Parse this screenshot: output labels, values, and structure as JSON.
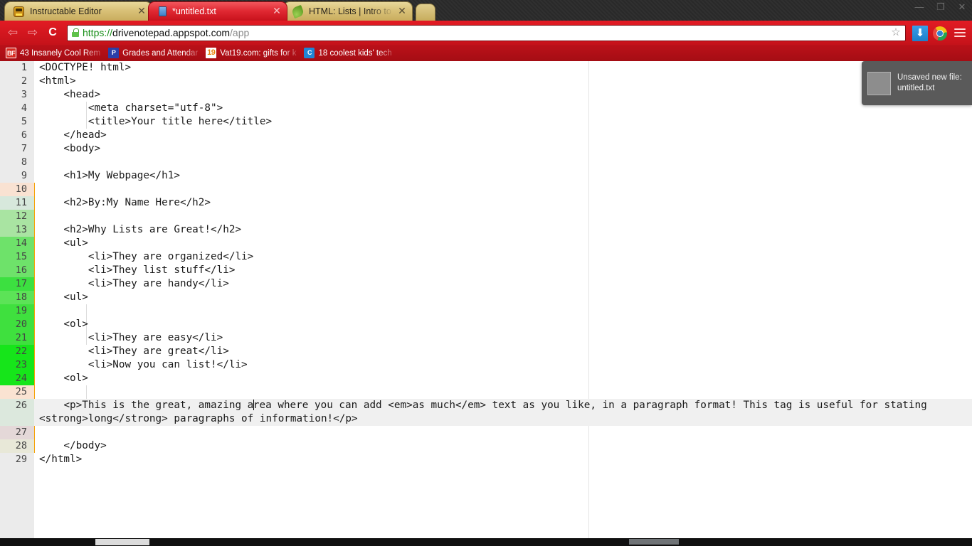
{
  "window": {
    "controls": [
      {
        "name": "minimize",
        "glyph": "—"
      },
      {
        "name": "maximize",
        "glyph": "❐"
      },
      {
        "name": "close",
        "glyph": "✕"
      }
    ]
  },
  "tabs": [
    {
      "title": "Instructable Editor",
      "favicon": "robot-icon",
      "active": false,
      "close": "✕"
    },
    {
      "title": "*untitled.txt",
      "favicon": "document-icon",
      "active": true,
      "close": "✕"
    },
    {
      "title": "HTML: Lists | Intro to HT",
      "favicon": "leaf-icon",
      "active": false,
      "close": "✕"
    }
  ],
  "toolbar": {
    "back": "⇦",
    "forward": "⇨",
    "reload": "C",
    "lock": "lock-icon",
    "url_scheme": "https://",
    "url_host": "drivenotepad.appspot.com",
    "url_path": "/app",
    "bookmark_star": "☆",
    "download_icon": "⬇",
    "profile_icon": "chrome-icon",
    "menu_icon": "hamburger-icon"
  },
  "bookmarks": [
    {
      "label": "43 Insanely Cool Rem",
      "favicon_text": "BF",
      "favicon_style": "bmf-bf"
    },
    {
      "label": "Grades and Attendar",
      "favicon_text": "P",
      "favicon_style": "bmf-p"
    },
    {
      "label": "Vat19.com: gifts for k",
      "favicon_text": "19",
      "favicon_style": "bmf-19"
    },
    {
      "label": "18 coolest kids' tech",
      "favicon_text": "C",
      "favicon_style": "bmf-c"
    }
  ],
  "toast": {
    "line1": "Unsaved new file:",
    "line2": "untitled.txt"
  },
  "editor": {
    "lines": [
      {
        "n": "1",
        "text": "<DOCTYPE! html>",
        "gutter": "#ebebeb"
      },
      {
        "n": "2",
        "text": "<html>",
        "gutter": "#ebebeb"
      },
      {
        "n": "3",
        "text": "    <head>",
        "gutter": "#ebebeb"
      },
      {
        "n": "4",
        "text": "        <meta charset=\"utf-8\">",
        "gutter": "#ebebeb"
      },
      {
        "n": "5",
        "text": "        <title>Your title here</title>",
        "gutter": "#ebebeb"
      },
      {
        "n": "6",
        "text": "    </head>",
        "gutter": "#ebebeb"
      },
      {
        "n": "7",
        "text": "    <body>",
        "gutter": "#ebebeb"
      },
      {
        "n": "8",
        "text": "",
        "gutter": "#ebebeb"
      },
      {
        "n": "9",
        "text": "    <h1>My Webpage</h1>",
        "gutter": "#ebebeb"
      },
      {
        "n": "10",
        "text": "",
        "gutter": "#f9e2d2"
      },
      {
        "n": "11",
        "text": "    <h2>By:My Name Here</h2>",
        "gutter": "#d7e8dc"
      },
      {
        "n": "12",
        "text": "",
        "gutter": "#a9e4a2"
      },
      {
        "n": "13",
        "text": "    <h2>Why Lists are Great!</h2>",
        "gutter": "#a9e4a2"
      },
      {
        "n": "14",
        "text": "    <ul>",
        "gutter": "#6ee26a"
      },
      {
        "n": "15",
        "text": "        <li>They are organized</li>",
        "gutter": "#6ee26a"
      },
      {
        "n": "16",
        "text": "        <li>They list stuff</li>",
        "gutter": "#6ee26a"
      },
      {
        "n": "17",
        "text": "        <li>They are handy</li>",
        "gutter": "#3ce040"
      },
      {
        "n": "18",
        "text": "    <ul>",
        "gutter": "#5ce357"
      },
      {
        "n": "19",
        "text": "",
        "gutter": "#3fe03e"
      },
      {
        "n": "20",
        "text": "    <ol>",
        "gutter": "#3fe03e"
      },
      {
        "n": "21",
        "text": "        <li>They are easy</li>",
        "gutter": "#3fe03e"
      },
      {
        "n": "22",
        "text": "        <li>They are great</li>",
        "gutter": "#16e51a"
      },
      {
        "n": "23",
        "text": "        <li>Now you can list!</li>",
        "gutter": "#16e51a"
      },
      {
        "n": "24",
        "text": "    <ol>",
        "gutter": "#16e51a"
      },
      {
        "n": "25",
        "text": "",
        "gutter": "#fae3d2"
      },
      {
        "n": "26",
        "text": "PARAGRAPH",
        "gutter": "#dce8dd",
        "wrapped": true
      },
      {
        "n": "27",
        "text": "",
        "gutter": "#e4d8d8"
      },
      {
        "n": "28",
        "text": "    </body>",
        "gutter": "#e8e8d8"
      },
      {
        "n": "29",
        "text": "</html>",
        "gutter": "#ebebeb"
      }
    ],
    "paragraph_before_caret": "    <p>This is the great, amazing a",
    "paragraph_after_caret": "rea where you can add <em>as much</em> text as you like, in a paragraph format! This tag is useful for stating <strong>long</strong> paragraphs of information!</p>",
    "active_line": "26",
    "caret_line": "26"
  }
}
